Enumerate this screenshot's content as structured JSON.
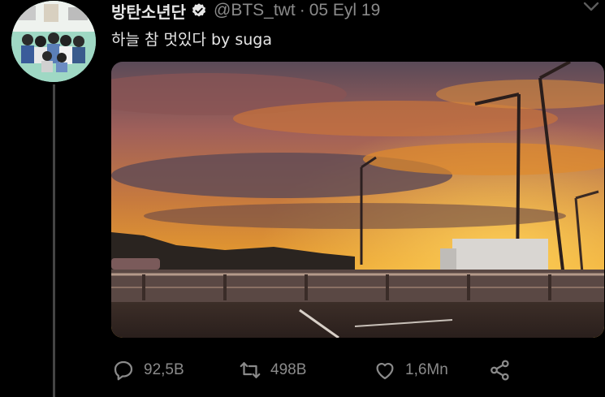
{
  "tweet": {
    "author": {
      "display_name": "방탄소년단",
      "handle": "@BTS_twt"
    },
    "separator": "·",
    "date": "05 Eyl 19",
    "text": "하늘 참 멋있다 by suga"
  },
  "actions": {
    "reply_count": "92,5B",
    "retweet_count": "498B",
    "like_count": "1,6Mn"
  },
  "icons": {
    "verified": "verified-badge-icon",
    "caret": "chevron-down-icon",
    "reply": "reply-icon",
    "retweet": "retweet-icon",
    "like": "heart-icon",
    "share": "share-icon"
  },
  "colors": {
    "background": "#000000",
    "muted_text": "#8a8a8a",
    "thread_line": "#444444"
  }
}
